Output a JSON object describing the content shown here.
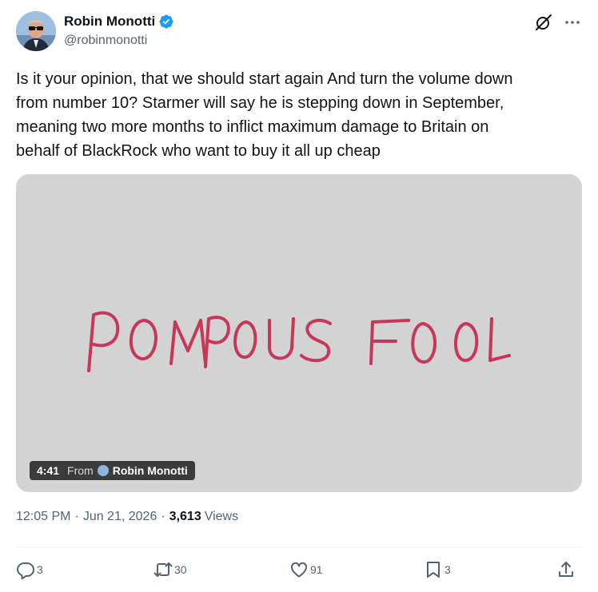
{
  "author": {
    "display_name": "Robin Monotti",
    "handle": "@robinmonotti"
  },
  "icons": {
    "verified": "verified-badge-icon",
    "grok": "grok-icon",
    "more": "more-icon",
    "reply": "reply-icon",
    "repost": "repost-icon",
    "like": "like-icon",
    "bookmark": "bookmark-icon",
    "share": "share-icon"
  },
  "colors": {
    "verified": "#1d9bf0",
    "drawing_ink": "#c8375a",
    "media_background": "#d3d3d3"
  },
  "tweet": {
    "text": "Is it your opinion, that we should start again And turn the volume down\nfrom number 10? Starmer will say he is stepping down in September,\nmeaning two more months to inflict maximum damage to Britain on\nbehalf of BlackRock who want to buy it all up cheap"
  },
  "media": {
    "handwritten_text": "POMPOUS FOOL",
    "duration": "4:41",
    "from_label": "From",
    "source_name": "Robin Monotti"
  },
  "meta": {
    "time": "12:05 PM",
    "date": "Jun 21, 2026",
    "views_count": "3,613",
    "views_label": "Views"
  },
  "actions": {
    "replies": "3",
    "reposts": "30",
    "likes": "91",
    "bookmarks": "3"
  }
}
